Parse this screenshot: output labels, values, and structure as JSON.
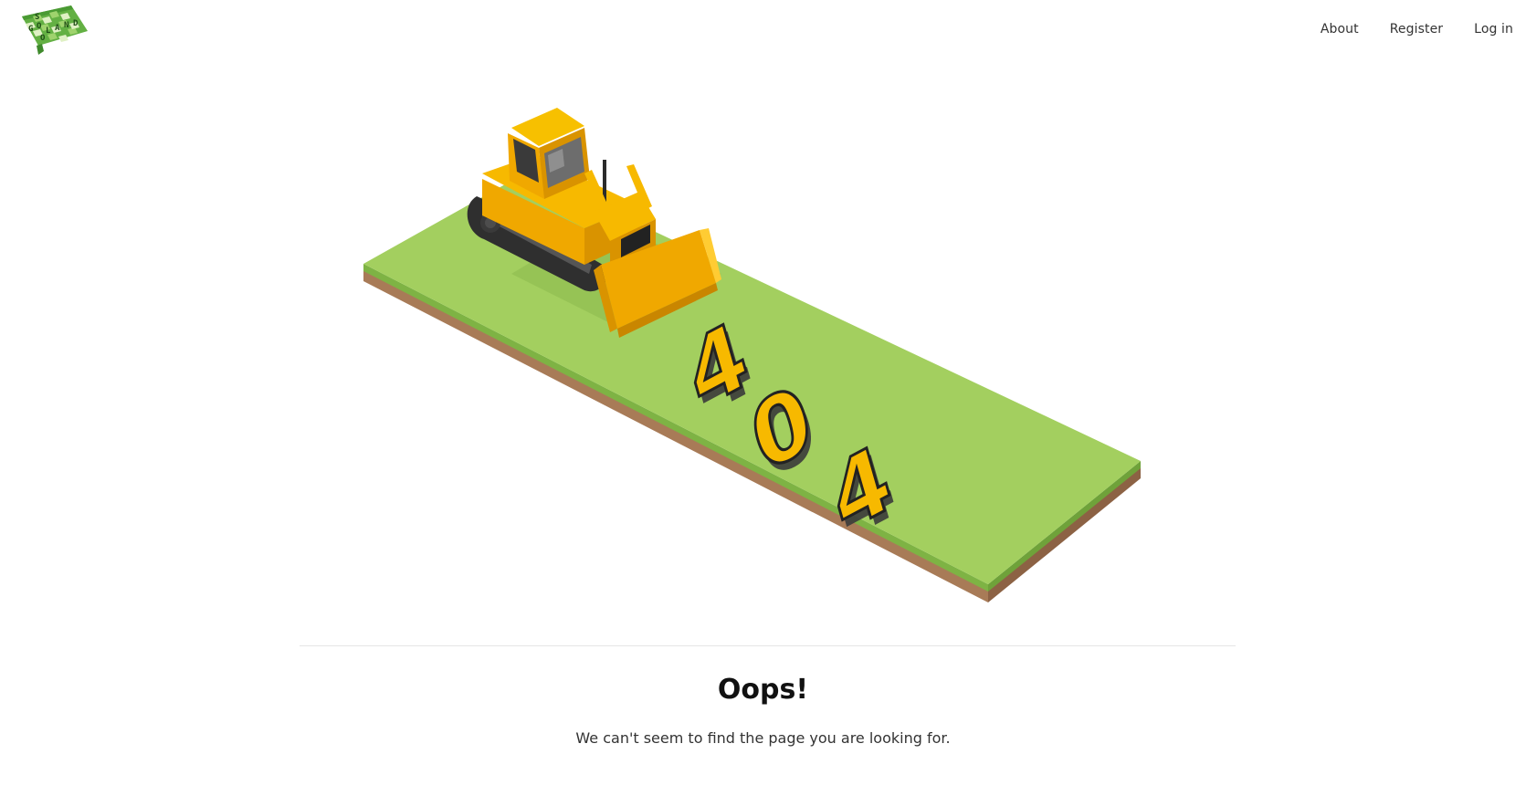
{
  "brand": {
    "logo_letters": [
      "S",
      "G",
      "O",
      "L",
      "A",
      "N",
      "D",
      "O"
    ]
  },
  "nav": {
    "about": "About",
    "register": "Register",
    "login": "Log in"
  },
  "illustration": {
    "digits": [
      "4",
      "0",
      "4"
    ]
  },
  "error": {
    "title": "Oops!",
    "message": "We can't seem to find the page you are looking for."
  },
  "colors": {
    "grass": "#a3cf5f",
    "soil": "#a87b57",
    "bulldozer": "#f7b900",
    "accent": "#2e8b3a"
  }
}
